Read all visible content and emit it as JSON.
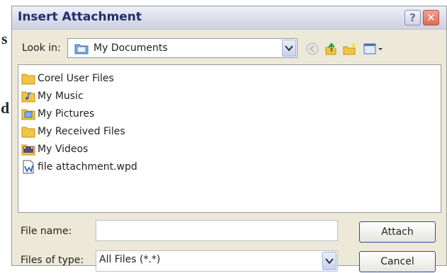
{
  "dialog": {
    "title": "Insert Attachment",
    "help_label": "?",
    "close_label": "✕"
  },
  "lookin": {
    "label": "Look in:",
    "value": "My Documents"
  },
  "toolbar": {
    "icons": [
      "back-icon",
      "up-folder-icon",
      "new-folder-icon",
      "views-menu-icon"
    ]
  },
  "files": [
    {
      "name": "Corel User Files",
      "icon": "folder-icon"
    },
    {
      "name": "My Music",
      "icon": "music-folder-icon"
    },
    {
      "name": "My Pictures",
      "icon": "pictures-folder-icon"
    },
    {
      "name": "My Received Files",
      "icon": "folder-icon"
    },
    {
      "name": "My Videos",
      "icon": "videos-folder-icon"
    },
    {
      "name": "file attachment.wpd",
      "icon": "wpd-file-icon"
    }
  ],
  "filename": {
    "label": "File name:",
    "value": ""
  },
  "filetype": {
    "label": "Files of type:",
    "value": "All Files (*.*)"
  },
  "buttons": {
    "attach": "Attach",
    "cancel": "Cancel"
  },
  "background": {
    "chars": [
      "s",
      "d"
    ]
  },
  "colors": {
    "title": "#1f2f6e",
    "folder": "#f2c443",
    "close": "#e06a52"
  }
}
